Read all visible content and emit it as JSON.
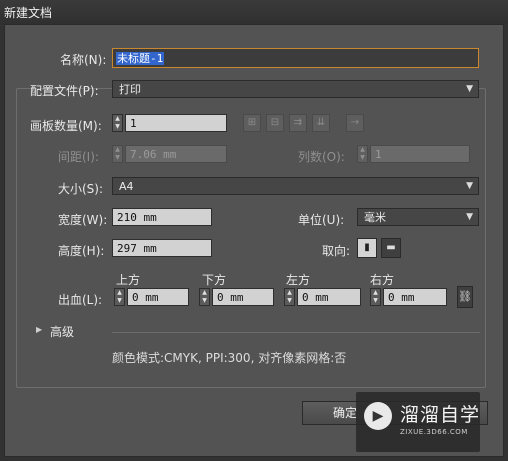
{
  "window": {
    "title": "新建文档"
  },
  "form": {
    "name_label": "名称(N):",
    "name_value": "未标题-1",
    "profile_label": "配置文件(P):",
    "profile_value": "打印",
    "artboards_label": "画板数量(M):",
    "artboards_value": "1",
    "spacing_label": "间距(I):",
    "spacing_value": "7.06 mm",
    "columns_label": "列数(O):",
    "columns_value": "1",
    "size_label": "大小(S):",
    "size_value": "A4",
    "width_label": "宽度(W):",
    "width_value": "210 mm",
    "units_label": "单位(U):",
    "units_value": "毫米",
    "height_label": "高度(H):",
    "height_value": "297 mm",
    "orientation_label": "取向:",
    "bleed_label": "出血(L):",
    "bleed": {
      "top_label": "上方",
      "top_value": "0 mm",
      "bottom_label": "下方",
      "bottom_value": "0 mm",
      "left_label": "左方",
      "left_value": "0 mm",
      "right_label": "右方",
      "right_value": "0 mm"
    },
    "advanced_label": "高级",
    "summary": "颜色模式:CMYK, PPI:300, 对齐像素网格:否"
  },
  "buttons": {
    "ok_label": "确定"
  },
  "watermark": {
    "brand": "溜溜自学",
    "url": "ZIXUE.3D66.COM"
  },
  "icons": {
    "spinner": "up-down-arrows",
    "arrangement": [
      "grid-by-row-icon",
      "grid-by-column-icon",
      "arrange-by-row-icon",
      "arrange-by-column-icon",
      "right-to-left-icon"
    ],
    "orientation": [
      "portrait-icon",
      "landscape-icon"
    ],
    "bleed_link": "chain-link-icon",
    "disclosure": "triangle-right-icon"
  },
  "colors": {
    "dialog_bg": "#535353",
    "name_focus_border": "#c9882f",
    "selection": "#3366cc"
  }
}
